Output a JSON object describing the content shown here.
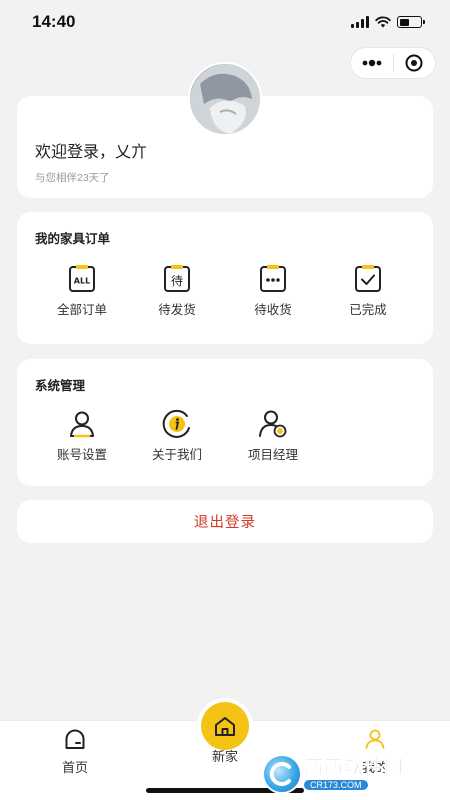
{
  "status_bar": {
    "time": "14:40",
    "battery_level": 0.45
  },
  "capsule": {
    "menu_icon": "more-dots-icon",
    "close_icon": "record-circle-icon"
  },
  "profile": {
    "welcome": "欢迎登录，乂亣",
    "days_text": "与您相伴23天了"
  },
  "orders": {
    "title": "我的家具订单",
    "items": [
      {
        "label": "全部订单",
        "icon": "all-orders-icon",
        "icon_text": "ALL"
      },
      {
        "label": "待发货",
        "icon": "pending-shipment-icon",
        "icon_text": "待"
      },
      {
        "label": "待收货",
        "icon": "pending-receipt-icon"
      },
      {
        "label": "已完成",
        "icon": "completed-icon"
      }
    ]
  },
  "system": {
    "title": "系统管理",
    "items": [
      {
        "label": "账号设置",
        "icon": "user-icon"
      },
      {
        "label": "关于我们",
        "icon": "info-icon"
      },
      {
        "label": "项目经理",
        "icon": "manager-icon"
      }
    ]
  },
  "logout": {
    "label": "退出登录"
  },
  "tab_bar": {
    "tabs": [
      {
        "label": "首页",
        "icon": "home-tab-icon"
      },
      {
        "label": "新家",
        "icon": "house-icon"
      },
      {
        "label": "我的",
        "icon": "profile-tab-icon",
        "active": true
      }
    ]
  },
  "watermark": {
    "main": "西西软件园",
    "sub": "CR173.COM"
  },
  "colors": {
    "accent": "#f5c315",
    "logout": "#d23a2a",
    "background": "#f2f2f2"
  }
}
